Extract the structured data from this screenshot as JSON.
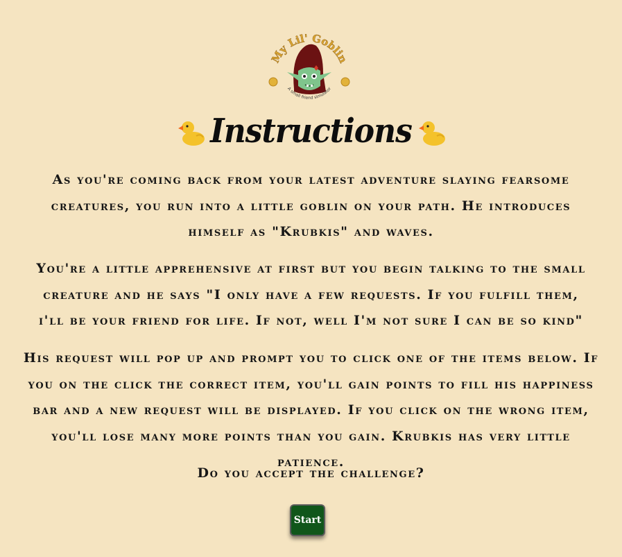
{
  "logo": {
    "title": "My Lil' Goblin",
    "subtitle": "A small friend simulator"
  },
  "header": {
    "title": "Instructions",
    "left_icon": "rubber-duck-icon",
    "right_icon": "rubber-duck-icon"
  },
  "instructions": {
    "paragraph1": "As you're coming back from your latest adventure slaying fearsome creatures, you run into a little goblin on your path. He introduces himself as \"Krubkis\" and waves.",
    "paragraph2": "You're a little apprehensive at first but you begin talking to the small creature and he says \"I only have a few requests. If you fulfill them, i'll be your friend for life. If not, well I'm not sure I can be so kind\"",
    "paragraph3": "His request will pop up and prompt you to click one of the items below. If you on the click the correct item, you'll gain points to fill his happiness bar and a new request will be displayed. If you click on the wrong item, you'll lose many more points than you gain. Krubkis has very little patience.",
    "question": "Do you accept the challenge?"
  },
  "actions": {
    "start_label": "Start"
  },
  "colors": {
    "background": "#f5e4c1",
    "button": "#10561a",
    "text": "#161616",
    "logo_gold": "#d9a531"
  }
}
